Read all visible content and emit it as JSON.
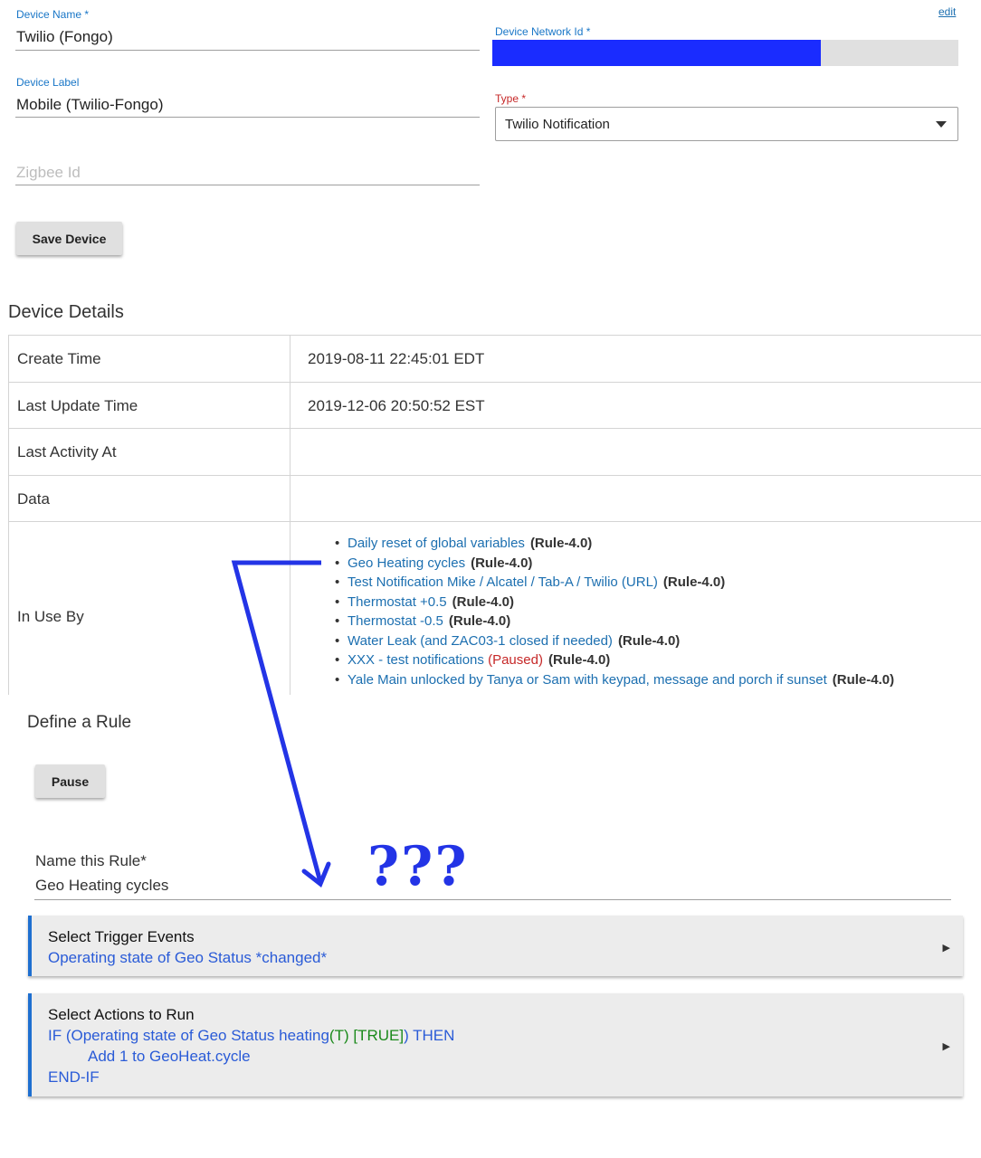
{
  "device_form": {
    "edit_link": "edit",
    "device_name": {
      "label": "Device Name *",
      "value": "Twilio (Fongo)"
    },
    "device_network_id": {
      "label": "Device Network Id *",
      "value": ""
    },
    "device_label": {
      "label": "Device Label",
      "value": "Mobile (Twilio-Fongo)"
    },
    "type": {
      "label": "Type *",
      "selected": "Twilio Notification"
    },
    "zigbee_id": {
      "placeholder": "Zigbee Id"
    },
    "save_button": "Save Device",
    "dropdown_icon": "caret-down-icon"
  },
  "device_details": {
    "heading": "Device Details",
    "rows": [
      {
        "key": "Create Time",
        "value": "2019-08-11 22:45:01 EDT"
      },
      {
        "key": "Last Update Time",
        "value": "2019-12-06 20:50:52 EST"
      },
      {
        "key": "Last Activity At",
        "value": ""
      },
      {
        "key": "Data",
        "value": ""
      },
      {
        "key": "In Use By",
        "value": ""
      }
    ],
    "in_use_by": [
      {
        "name": "Daily reset of global variables",
        "status": "",
        "type": "(Rule-4.0)"
      },
      {
        "name": "Geo Heating cycles",
        "status": "",
        "type": "(Rule-4.0)"
      },
      {
        "name": "Test Notification Mike / Alcatel / Tab-A / Twilio (URL)",
        "status": "",
        "type": "(Rule-4.0)"
      },
      {
        "name": "Thermostat +0.5",
        "status": "",
        "type": "(Rule-4.0)"
      },
      {
        "name": "Thermostat -0.5",
        "status": "",
        "type": "(Rule-4.0)"
      },
      {
        "name": "Water Leak (and ZAC03-1 closed if needed)",
        "status": "",
        "type": "(Rule-4.0)"
      },
      {
        "name": "XXX - test notifications",
        "status": "(Paused)",
        "type": "(Rule-4.0)"
      },
      {
        "name": "Yale Main unlocked by Tanya or Sam with keypad, message and porch if sunset",
        "status": "",
        "type": "(Rule-4.0)"
      }
    ]
  },
  "rule": {
    "heading": "Define a Rule",
    "pause_button": "Pause",
    "name_label": "Name this Rule*",
    "name_value": "Geo Heating cycles",
    "annotation": "???",
    "annotation_icon": "arrow-annotation-icon",
    "triggers": {
      "title": "Select Trigger Events",
      "line": "Operating state of Geo Status *changed*"
    },
    "actions": {
      "title": "Select Actions to Run",
      "if_prefix": "IF (Operating state of Geo Status heating",
      "if_t": "(T) [TRUE]",
      "if_suffix": ") THEN",
      "action": "Add 1 to GeoHeat.cycle",
      "end": "END-IF"
    },
    "expand_icon": "triangle-right-icon"
  },
  "colors": {
    "link": "#1c6fb0",
    "accent_blue": "#1e6fd0",
    "network_id_fill": "#1a2cff",
    "paused": "#c62828",
    "true_green": "#1b8a1b",
    "annotation_blue": "#2334e6"
  }
}
